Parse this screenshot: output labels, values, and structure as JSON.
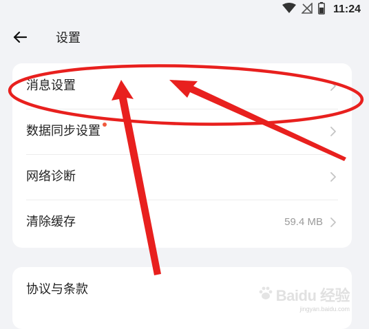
{
  "status_bar": {
    "time": "11:24",
    "icons": [
      "wifi-icon",
      "signal-off-icon",
      "battery-icon"
    ]
  },
  "header": {
    "title": "设置",
    "back_icon": "arrow-left-icon"
  },
  "settings": {
    "group1": [
      {
        "label": "消息设置",
        "value": "",
        "badge": false
      },
      {
        "label": "数据同步设置",
        "value": "",
        "badge": true
      },
      {
        "label": "网络诊断",
        "value": "",
        "badge": false
      },
      {
        "label": "清除缓存",
        "value": "59.4 MB",
        "badge": false
      }
    ],
    "group2": [
      {
        "label": "协议与条款",
        "value": "",
        "badge": false
      }
    ]
  },
  "colors": {
    "background": "#f2f3f6",
    "card": "#ffffff",
    "annotation": "#e8201e",
    "badge": "#f05a3d"
  },
  "watermark": {
    "text": "Baidu 经验",
    "sub": "jingyan.baidu.com"
  }
}
